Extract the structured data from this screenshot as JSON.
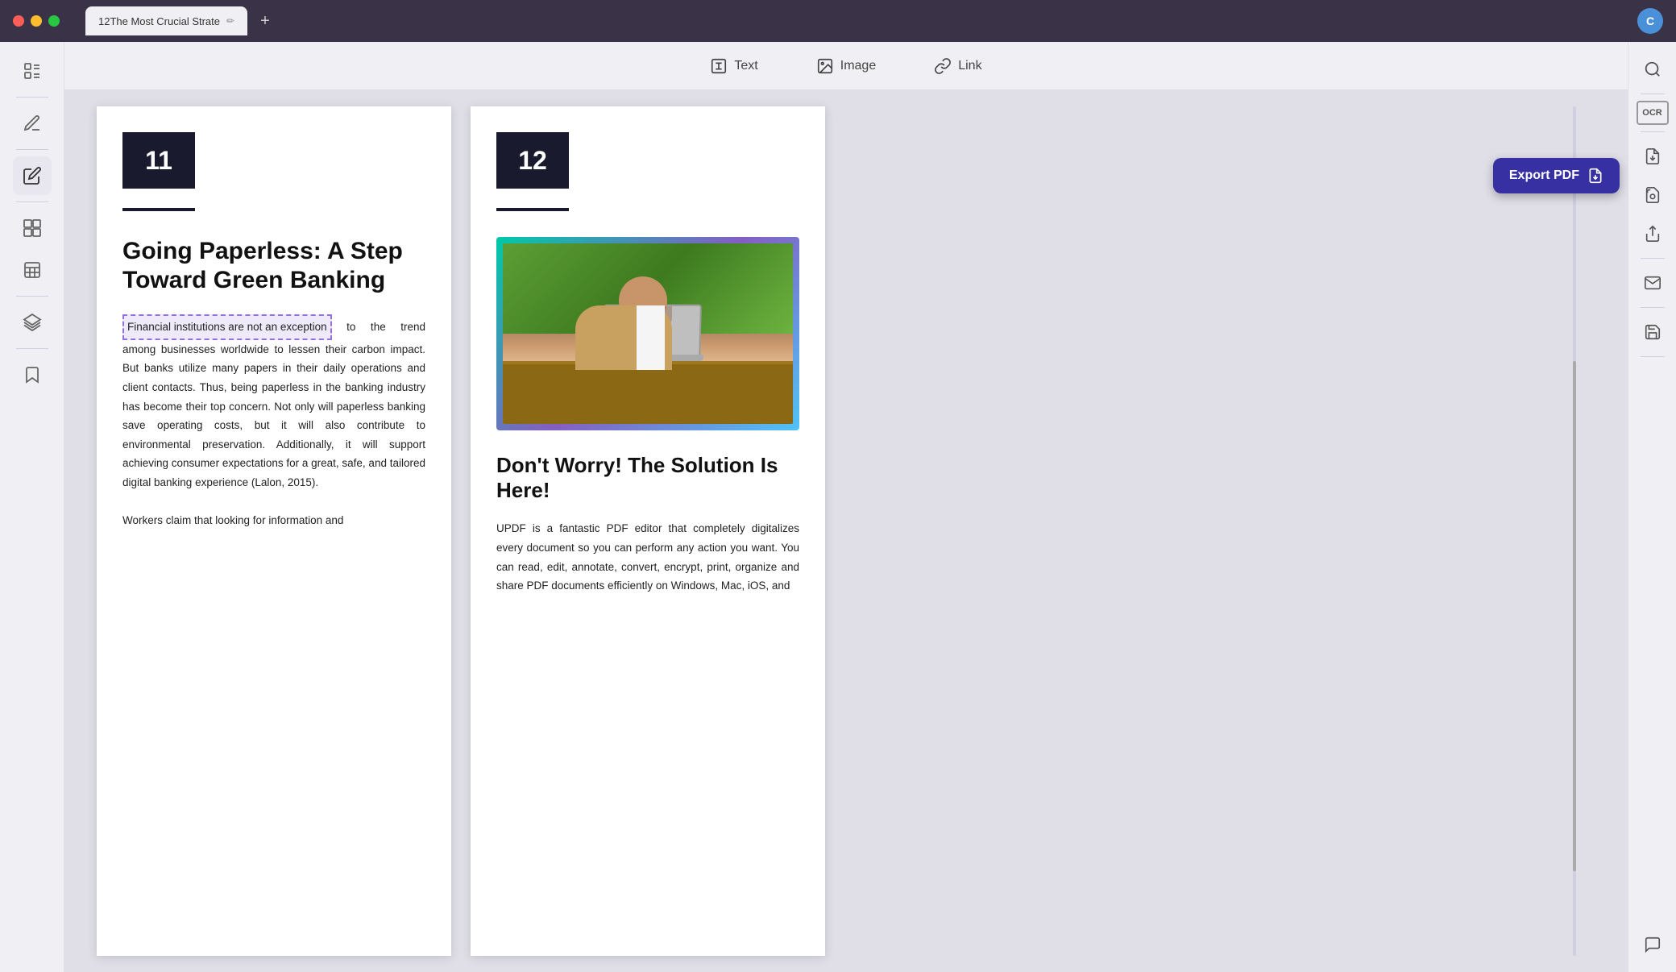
{
  "titlebar": {
    "tab_title": "12The Most Crucial Strate",
    "add_tab_label": "+",
    "user_initial": "C"
  },
  "toolbar": {
    "text_label": "Text",
    "image_label": "Image",
    "link_label": "Link"
  },
  "sidebar": {
    "icons": [
      {
        "name": "document-list-icon",
        "symbol": "≡"
      },
      {
        "name": "annotation-icon",
        "symbol": "✎"
      },
      {
        "name": "edit-icon",
        "symbol": "✏"
      },
      {
        "name": "pages-icon",
        "symbol": "⊞"
      },
      {
        "name": "table-icon",
        "symbol": "⊟"
      },
      {
        "name": "layers-icon",
        "symbol": "◈"
      },
      {
        "name": "bookmark-icon",
        "symbol": "⊡"
      }
    ]
  },
  "right_sidebar": {
    "icons": [
      {
        "name": "search-icon",
        "symbol": "⌕"
      },
      {
        "name": "ocr-icon",
        "symbol": "OCR"
      },
      {
        "name": "export-pdf-icon",
        "symbol": "↗"
      },
      {
        "name": "document-scan-icon",
        "symbol": "⊡"
      },
      {
        "name": "share-icon",
        "symbol": "↑"
      },
      {
        "name": "email-icon",
        "symbol": "✉"
      },
      {
        "name": "save-icon",
        "symbol": "💾"
      },
      {
        "name": "chat-icon",
        "symbol": "💬"
      }
    ],
    "export_pdf_button": "Export PDF"
  },
  "page1": {
    "number": "11",
    "heading": "Going Paperless: A Step Toward Green Banking",
    "highlighted_sentence": "Financial institutions are not an exception",
    "body_text": " to the trend among businesses worldwide to lessen their carbon impact. But banks utilize many papers in their daily operations and client contacts. Thus, being paperless in the banking industry has become their top concern. Not only will paperless banking save operating costs, but it will also contribute to environmental preservation. Additionally, it will support achieving consumer expectations for a great, safe, and tailored digital banking experience (Lalon, 2015).",
    "body_text2": "Workers claim that looking for information and"
  },
  "page2": {
    "number": "12",
    "heading2": "Don't Worry! The Solution Is Here!",
    "body_text": "UPDF is a fantastic PDF editor that completely digitalizes every document so you can perform any action you want. You can read, edit, annotate, convert, encrypt, print, organize and share PDF documents efficiently on Windows, Mac, iOS, and"
  },
  "colors": {
    "sidebar_bg": "#f0eff4",
    "accent_purple": "#3730a3",
    "highlight_purple": "#9370db",
    "page_number_bg": "#1a1a2e",
    "image_border": "linear-gradient(135deg, #00c9a7, #845ec2, #4fc3f7)"
  }
}
